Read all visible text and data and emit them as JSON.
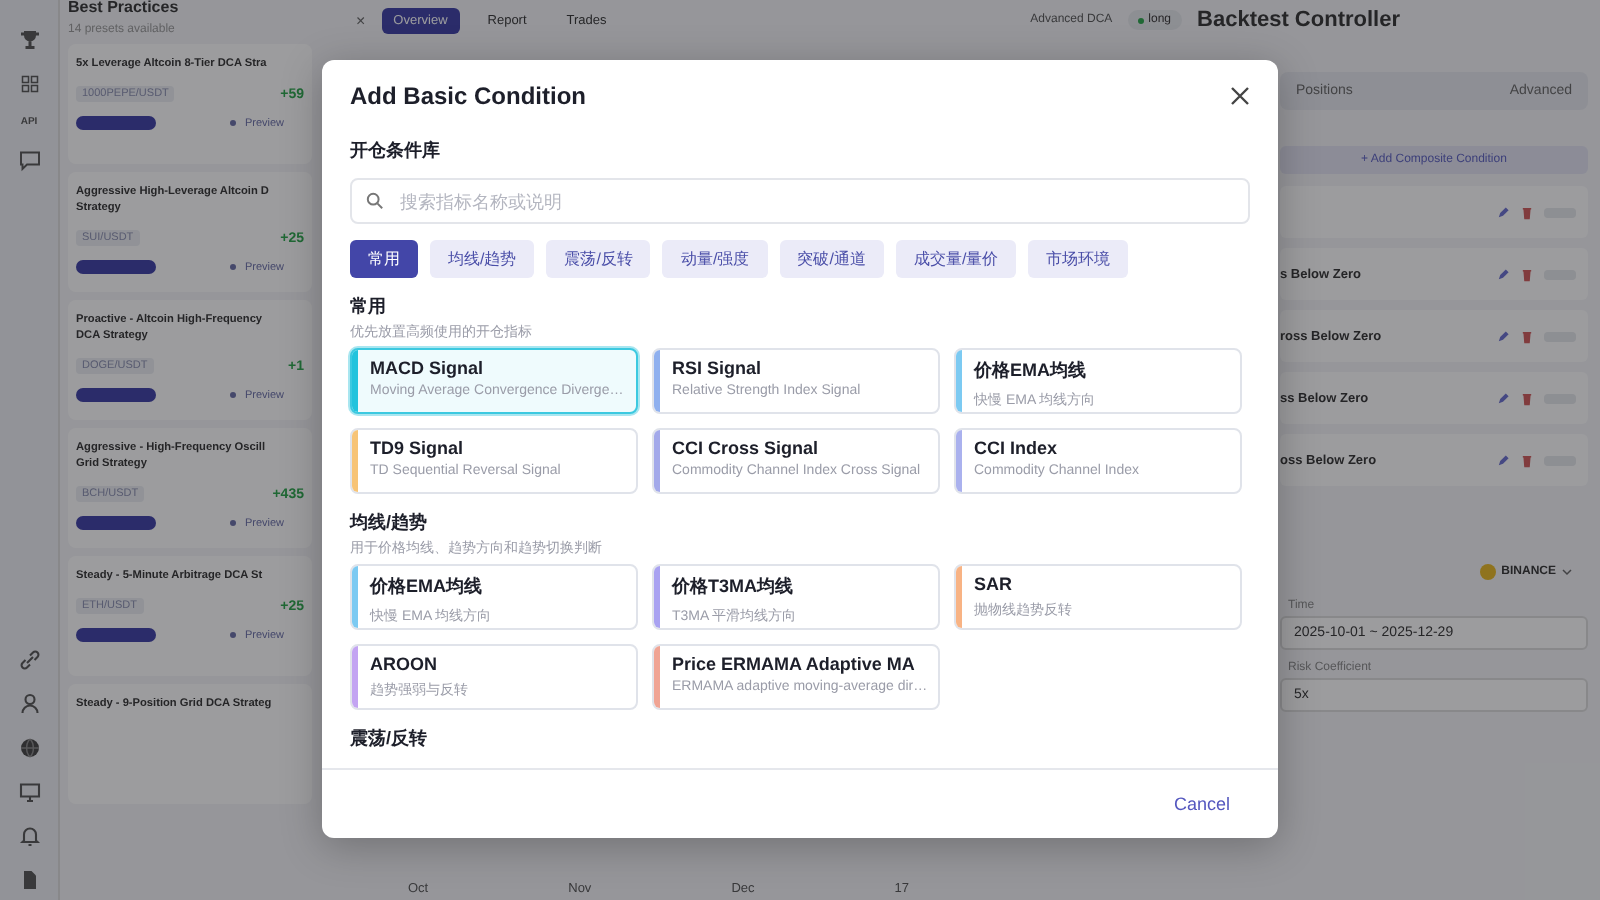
{
  "app": {
    "rail": [
      {
        "kind": "trophy"
      },
      {
        "kind": "grid"
      },
      {
        "kind": "text",
        "label": "API"
      },
      {
        "kind": "chat"
      },
      {
        "kind": "link"
      },
      {
        "kind": "user"
      },
      {
        "kind": "globe"
      },
      {
        "kind": "monitor"
      },
      {
        "kind": "bell"
      },
      {
        "kind": "file"
      }
    ],
    "top_bar": {
      "close": "×",
      "tabs": [
        {
          "label": "Overview",
          "selected": true
        },
        {
          "label": "Report",
          "selected": false
        },
        {
          "label": "Trades",
          "selected": false
        }
      ],
      "strategy_type": "Advanced DCA",
      "direction": "long",
      "title": "Backtest Controller"
    },
    "presets": {
      "title": "Best Practices",
      "count": "14 presets available",
      "items": [
        {
          "name_lines": [
            "5x Leverage Altcoin 8-Tier DCA Stra"
          ],
          "pair": "1000PEPE/USDT",
          "return": "+59",
          "action": "Preview"
        },
        {
          "name_lines": [
            "Aggressive High-Leverage Altcoin D",
            "Strategy"
          ],
          "pair": "SUI/USDT",
          "return": "+25",
          "action": "Preview"
        },
        {
          "name_lines": [
            "Proactive - Altcoin High-Frequency",
            "DCA Strategy"
          ],
          "pair": "DOGE/USDT",
          "return": "+1",
          "action": "Preview"
        },
        {
          "name_lines": [
            "Aggressive - High-Frequency Oscill",
            "Grid Strategy"
          ],
          "pair": "BCH/USDT",
          "return": "+435",
          "action": "Preview"
        },
        {
          "name_lines": [
            "Steady - 5-Minute Arbitrage DCA St"
          ],
          "pair": "ETH/USDT",
          "return": "+25",
          "action": "Preview"
        },
        {
          "name_lines": [
            "Steady - 9-Position Grid DCA Strateg"
          ]
        }
      ]
    },
    "side_panel": {
      "tabs": [
        "Positions",
        "Advanced"
      ],
      "add_button": "+ Add Composite Condition",
      "rows": [
        {},
        {
          "name": "s Below Zero"
        },
        {
          "name": "ross Below Zero"
        },
        {
          "name": "ss Below Zero"
        },
        {
          "name": "oss Below Zero"
        }
      ],
      "exchange": "BINANCE",
      "time_label": "Time",
      "time_value": "2025-10-01 ~ 2025-12-29",
      "risk_label": "Risk Coefficient",
      "risk_value": "5x"
    },
    "chart_axis": [
      "Oct",
      "Nov",
      "Dec",
      "17"
    ]
  },
  "modal": {
    "title": "Add Basic Condition",
    "section_title": "开仓条件库",
    "search": {
      "placeholder": "搜索指标名称或说明"
    },
    "categories": [
      {
        "label": "常用",
        "selected": true
      },
      {
        "label": "均线/趋势",
        "selected": false
      },
      {
        "label": "震荡/反转",
        "selected": false
      },
      {
        "label": "动量/强度",
        "selected": false
      },
      {
        "label": "突破/通道",
        "selected": false
      },
      {
        "label": "成交量/量价",
        "selected": false
      },
      {
        "label": "市场环境",
        "selected": false
      }
    ],
    "groups": [
      {
        "title": "常用",
        "subtitle": "优先放置高频使用的开仓指标",
        "conditions": [
          {
            "name": "MACD Signal",
            "description": "Moving Average Convergence Diverge…",
            "color": "#22c3dd",
            "selected": true
          },
          {
            "name": "RSI Signal",
            "description": "Relative Strength Index Signal",
            "color": "#8fb0ef",
            "selected": false
          },
          {
            "name": "价格EMA均线",
            "description": "快慢 EMA 均线方向",
            "color": "#7ccaf2",
            "selected": false
          },
          {
            "name": "TD9 Signal",
            "description": "TD Sequential Reversal Signal",
            "color": "#f7c477",
            "selected": false
          },
          {
            "name": "CCI Cross Signal",
            "description": "Commodity Channel Index Cross Signal",
            "color": "#a3a9ea",
            "selected": false
          },
          {
            "name": "CCI Index",
            "description": "Commodity Channel Index",
            "color": "#aab1ee",
            "selected": false
          }
        ]
      },
      {
        "title": "均线/趋势",
        "subtitle": "用于价格均线、趋势方向和趋势切换判断",
        "conditions": [
          {
            "name": "价格EMA均线",
            "description": "快慢 EMA 均线方向",
            "color": "#7ccaf2",
            "selected": false
          },
          {
            "name": "价格T3MA均线",
            "description": "T3MA 平滑均线方向",
            "color": "#a9a2f1",
            "selected": false
          },
          {
            "name": "SAR",
            "description": "抛物线趋势反转",
            "color": "#f8b384",
            "selected": false
          },
          {
            "name": "AROON",
            "description": "趋势强弱与反转",
            "color": "#c3a4f2",
            "selected": false
          },
          {
            "name": "Price ERMAMA Adaptive MA",
            "description": "ERMAMA adaptive moving-average dir…",
            "color": "#f0a494",
            "selected": false
          }
        ]
      },
      {
        "title": "震荡/反转"
      }
    ],
    "cancel": "Cancel"
  }
}
